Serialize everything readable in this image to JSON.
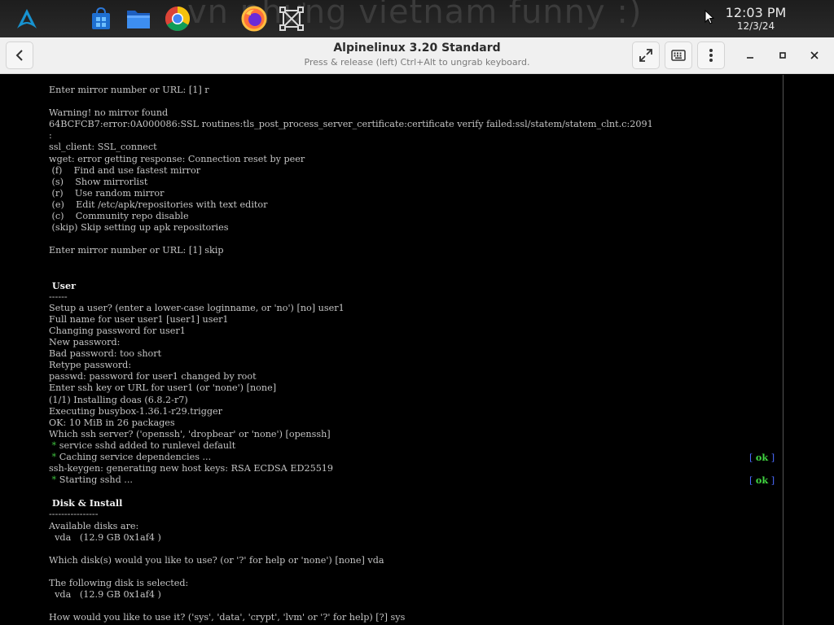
{
  "taskbar": {
    "wallpaper_text": "vn nhưng vietnam funny :)",
    "icons": [
      "arch-linux-logo-icon",
      "store-icon",
      "file-manager-icon",
      "chrome-icon",
      "firefox-icon",
      "screen-capture-icon"
    ],
    "clock_time": "12:03 PM",
    "clock_date": "12/3/24"
  },
  "window": {
    "title": "Alpinelinux 3.20 Standard",
    "subtitle": "Press & release (left) Ctrl+Alt to ungrab keyboard."
  },
  "terminal": {
    "lines": [
      {
        "text": "Enter mirror number or URL: [1] r"
      },
      {
        "text": ""
      },
      {
        "text": "Warning! no mirror found"
      },
      {
        "text": "64BCFCB7:error:0A000086:SSL routines:tls_post_process_server_certificate:certificate verify failed:ssl/statem/statem_clnt.c:2091"
      },
      {
        "text": ":"
      },
      {
        "text": "ssl_client: SSL_connect"
      },
      {
        "text": "wget: error getting response: Connection reset by peer"
      },
      {
        "text": " (f)    Find and use fastest mirror"
      },
      {
        "text": " (s)    Show mirrorlist"
      },
      {
        "text": " (r)    Use random mirror"
      },
      {
        "text": " (e)    Edit /etc/apk/repositories with text editor"
      },
      {
        "text": " (c)    Community repo disable"
      },
      {
        "text": " (skip) Skip setting up apk repositories"
      },
      {
        "text": ""
      },
      {
        "text": "Enter mirror number or URL: [1] skip"
      },
      {
        "text": ""
      },
      {
        "text": ""
      },
      {
        "text": " User",
        "bold": true
      },
      {
        "text": "------"
      },
      {
        "text": "Setup a user? (enter a lower-case loginname, or 'no') [no] user1"
      },
      {
        "text": "Full name for user user1 [user1] user1"
      },
      {
        "text": "Changing password for user1"
      },
      {
        "text": "New password:"
      },
      {
        "text": "Bad password: too short"
      },
      {
        "text": "Retype password:"
      },
      {
        "text": "passwd: password for user1 changed by root"
      },
      {
        "text": "Enter ssh key or URL for user1 (or 'none') [none]"
      },
      {
        "text": "(1/1) Installing doas (6.8.2-r7)"
      },
      {
        "text": "Executing busybox-1.36.1-r29.trigger"
      },
      {
        "text": "OK: 10 MiB in 26 packages"
      },
      {
        "text": "Which ssh server? ('openssh', 'dropbear' or 'none') [openssh]"
      },
      {
        "star": " * ",
        "text": "service sshd added to runlevel default"
      },
      {
        "star": " * ",
        "text": "Caching service dependencies ...",
        "status": {
          "open": "[ ",
          "ok": "ok",
          "close": " ]"
        }
      },
      {
        "text": "ssh-keygen: generating new host keys: RSA ECDSA ED25519"
      },
      {
        "star": " * ",
        "text": "Starting sshd ...",
        "status": {
          "open": "[ ",
          "ok": "ok",
          "close": " ]"
        }
      },
      {
        "text": ""
      },
      {
        "text": " Disk & Install",
        "bold": true
      },
      {
        "text": "----------------"
      },
      {
        "text": "Available disks are:"
      },
      {
        "text": "  vda   (12.9 GB 0x1af4 )"
      },
      {
        "text": ""
      },
      {
        "text": "Which disk(s) would you like to use? (or '?' for help or 'none') [none] vda"
      },
      {
        "text": ""
      },
      {
        "text": "The following disk is selected:"
      },
      {
        "text": "  vda   (12.9 GB 0x1af4 )"
      },
      {
        "text": ""
      },
      {
        "text": "How would you like to use it? ('sys', 'data', 'crypt', 'lvm' or '?' for help) [?] sys"
      }
    ]
  }
}
